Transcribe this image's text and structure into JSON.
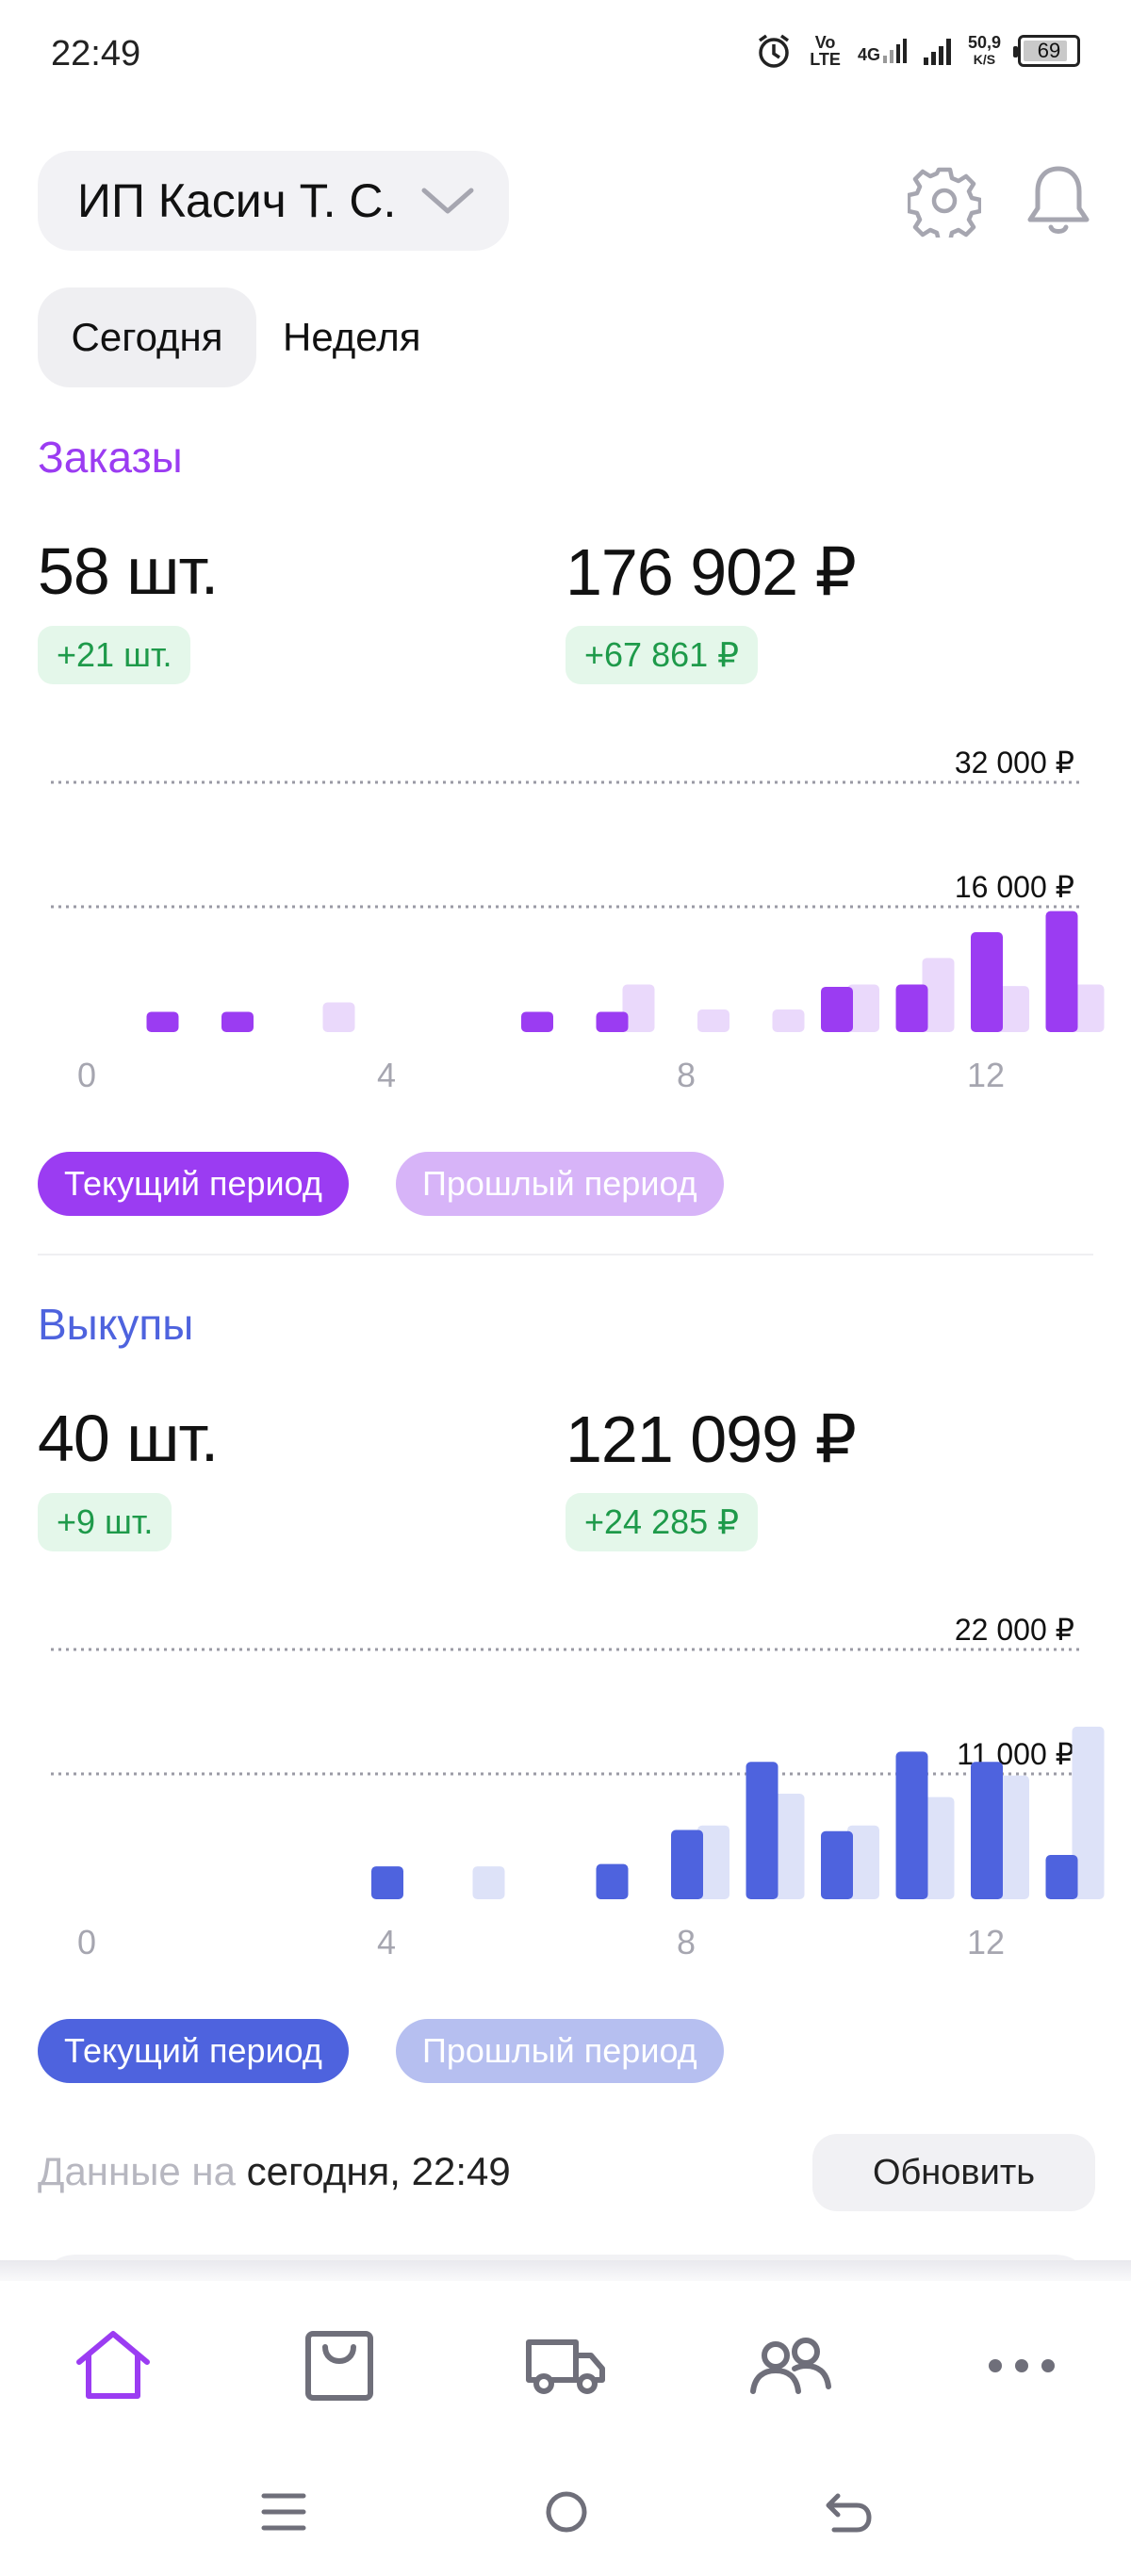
{
  "status_bar": {
    "time": "22:49",
    "volte_top": "Vo",
    "volte_bottom": "LTE",
    "network": "4G",
    "speed_value": "50,9",
    "speed_unit": "K/S",
    "battery": "69"
  },
  "header": {
    "account_name": "ИП Касич Т. С."
  },
  "period_toggle": {
    "today": "Сегодня",
    "week": "Неделя",
    "selected": "today"
  },
  "orders": {
    "title": "Заказы",
    "count": "58 шт.",
    "count_delta": "+21 шт.",
    "sum": "176 902 ₽",
    "sum_delta": "+67 861 ₽",
    "legend_current": "Текущий период",
    "legend_previous": "Прошлый период"
  },
  "buyouts": {
    "title": "Выкупы",
    "count": "40 шт.",
    "count_delta": "+9 шт.",
    "sum": "121 099 ₽",
    "sum_delta": "+24 285 ₽",
    "legend_current": "Текущий период",
    "legend_previous": "Прошлый период"
  },
  "footer": {
    "data_prefix": "Данные на",
    "data_time": "сегодня, 22:49",
    "refresh": "Обновить"
  },
  "colors": {
    "orders_current": "#9b3cf2",
    "orders_previous": "#ead9fb",
    "orders_legend_previous": "#d7b4f8",
    "buyouts_current": "#4e63de",
    "buyouts_previous": "#dde2f8",
    "buyouts_legend_previous": "#b6bff0",
    "accent_purple": "#9b3cf2",
    "accent_blue": "#4e63de"
  },
  "chart_data": [
    {
      "type": "bar",
      "name": "orders",
      "x_ticks": [
        "0",
        "4",
        "8",
        "12"
      ],
      "y_gridlines": [
        "32 000 ₽",
        "16 000 ₽"
      ],
      "ylim": [
        0,
        32000
      ],
      "hours": [
        0,
        1,
        2,
        3,
        4,
        5,
        6,
        7,
        8,
        9,
        10,
        11,
        12,
        13
      ],
      "series": [
        {
          "name": "Текущий период",
          "values": [
            0,
            2600,
            2600,
            0,
            0,
            0,
            2600,
            2600,
            0,
            0,
            5800,
            6100,
            12800,
            15500
          ]
        },
        {
          "name": "Прошлый период",
          "values": [
            0,
            0,
            0,
            3800,
            0,
            0,
            0,
            6100,
            2900,
            2900,
            6100,
            9500,
            5900,
            6100
          ]
        }
      ]
    },
    {
      "type": "bar",
      "name": "buyouts",
      "x_ticks": [
        "0",
        "4",
        "8",
        "12"
      ],
      "y_gridlines": [
        "22 000 ₽",
        "11 000 ₽"
      ],
      "ylim": [
        0,
        22000
      ],
      "hours": [
        0,
        1,
        2,
        3,
        4,
        5,
        6,
        7,
        8,
        9,
        10,
        11,
        12,
        13
      ],
      "series": [
        {
          "name": "Текущий период",
          "values": [
            0,
            0,
            0,
            0,
            2900,
            0,
            0,
            3100,
            6100,
            12100,
            6000,
            13000,
            12100,
            3900
          ]
        },
        {
          "name": "Прошлый период",
          "values": [
            0,
            0,
            0,
            0,
            0,
            2900,
            0,
            0,
            6500,
            9300,
            6500,
            9000,
            10900,
            15200
          ]
        }
      ]
    }
  ],
  "nav": {
    "items": [
      "home-icon",
      "bag-icon",
      "truck-icon",
      "users-icon",
      "more-icon"
    ]
  }
}
